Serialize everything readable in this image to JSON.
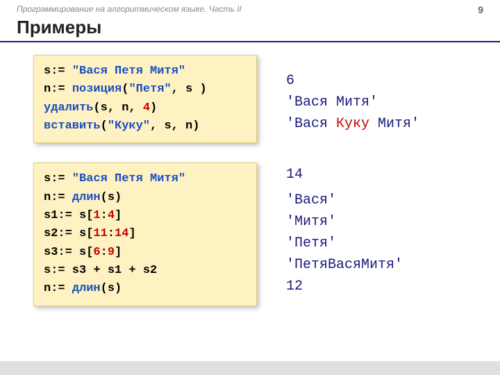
{
  "header": {
    "subtitle": "Программирование на алгоритмическом языке. Часть II",
    "page": "9"
  },
  "title": "Примеры",
  "block1": {
    "code": {
      "l1_a": "s:= ",
      "l1_b": "\"Вася Петя Митя\"",
      "l2_a": "n:= ",
      "l2_b": "позиция",
      "l2_c": "(",
      "l2_d": "\"Петя\"",
      "l2_e": ", s )",
      "l3_a": "удалить",
      "l3_b": "(s, n, ",
      "l3_c": "4",
      "l3_d": ")",
      "l4_a": "вставить",
      "l4_b": "(",
      "l4_c": "\"Куку\"",
      "l4_d": ", s, n)"
    },
    "out": {
      "r1": "6",
      "r2": "'Вася  Митя'",
      "r3_a": "'Вася ",
      "r3_b": "Куку",
      "r3_c": " Митя'"
    }
  },
  "block2": {
    "code": {
      "l1_a": "s:= ",
      "l1_b": "\"Вася Петя Митя\"",
      "l2_a": "n:= ",
      "l2_b": "длин",
      "l2_c": "(s)",
      "l3_a": "s1:= s[",
      "l3_b": "1",
      "l3_c": ":",
      "l3_d": "4",
      "l3_e": "]",
      "l4_a": "s2:= s[",
      "l4_b": "11",
      "l4_c": ":",
      "l4_d": "14",
      "l4_e": "]",
      "l5_a": "s3:= s[",
      "l5_b": "6",
      "l5_c": ":",
      "l5_d": "9",
      "l5_e": "]",
      "l6": "s:= s3 + s1 + s2",
      "l7_a": "n:= ",
      "l7_b": "длин",
      "l7_c": "(s)"
    },
    "out": {
      "r1": "14",
      "r2": "'Вася'",
      "r3": "'Митя'",
      "r4": "'Петя'",
      "r5": "'ПетяВасяМитя'",
      "r6": "12"
    }
  }
}
